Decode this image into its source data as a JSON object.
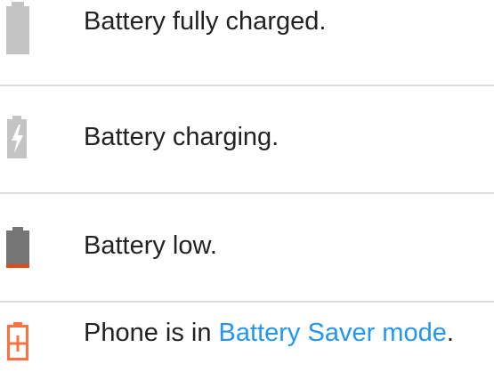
{
  "status_list": {
    "items": [
      {
        "icon": "battery-full-icon",
        "text": "Battery fully charged."
      },
      {
        "icon": "battery-charging-icon",
        "text": "Battery charging."
      },
      {
        "icon": "battery-low-icon",
        "text": "Battery low."
      },
      {
        "icon": "battery-saver-icon",
        "text_before": "Phone is in ",
        "link": "Battery Saver mode",
        "text_after": "."
      }
    ]
  },
  "colors": {
    "icon_gray": "#c4c4c4",
    "icon_dark": "#757575",
    "low_level": "#e64a19",
    "saver": "#ff7043",
    "link": "#2196f3",
    "divider": "#dcdcdc"
  }
}
